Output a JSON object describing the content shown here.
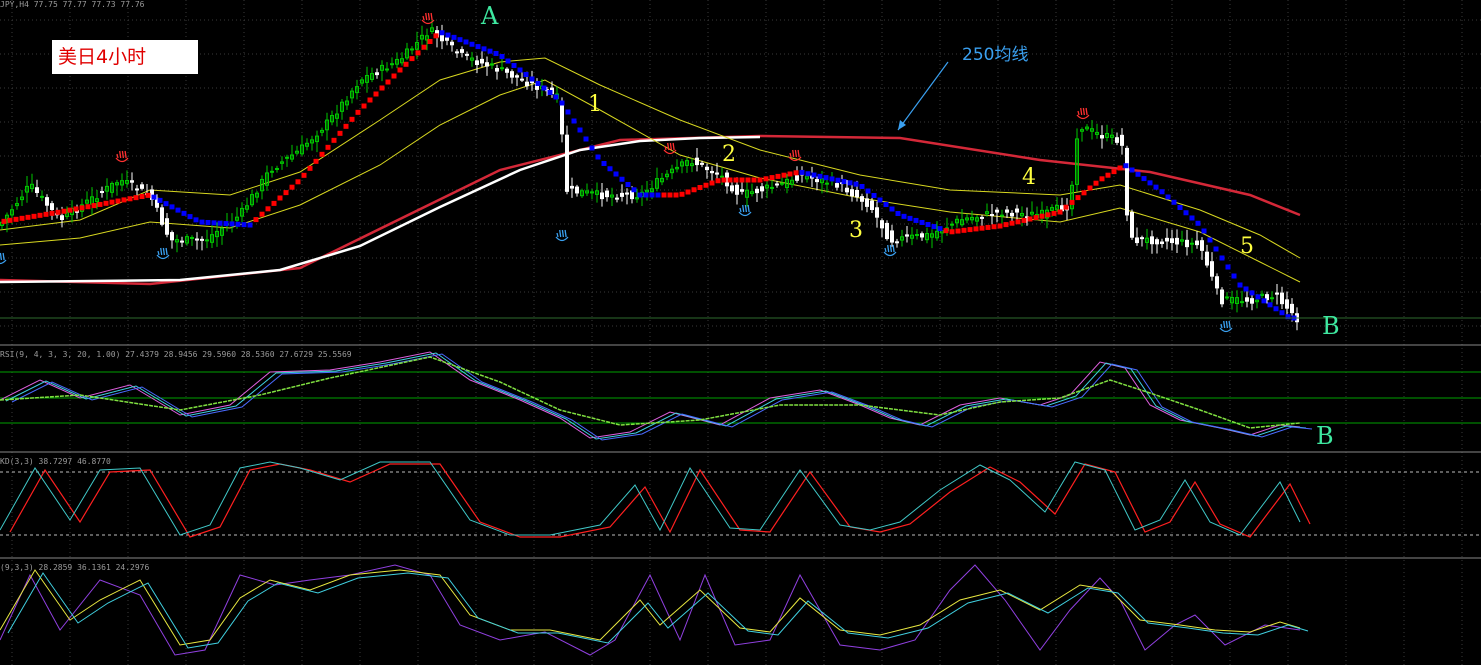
{
  "window": {
    "main_header": "JPY,H4  77.75 77.77 77.73 77.76",
    "rsi_header": "RSI(9, 4, 3, 3, 20, 1.00) 27.4379 28.9456 29.5960 28.5360 27.6729 25.5569",
    "kd_header": "KD(3,3) 38.7297 46.8770",
    "kdj_header": "(9,3,3) 28.2859 36.1361 24.2976"
  },
  "labels": {
    "title": "美日4小时",
    "ma_label": "250均线",
    "peak": "A",
    "bottom": "B",
    "bottom_rsi": "B",
    "wave": [
      "1",
      "2",
      "3",
      "4",
      "5"
    ]
  },
  "colors": {
    "background": "#000000",
    "grid": "#3a3a3a",
    "up_candle": "#00c800",
    "down_candle": "#ffffff",
    "ma250": "#d42838",
    "white_ma": "#ffffff",
    "envelope": "#d8d820",
    "trend_up": "#ff0000",
    "trend_down": "#0000ff",
    "label_green": "#3ee8a0",
    "label_yellow": "#ffff40",
    "label_blue": "#3aa0f0",
    "rsi_magenta": "#e060e0",
    "rsi_cyan": "#40d0e0",
    "rsi_green": "#80e040",
    "kd_red": "#ff2020",
    "kd_cyan": "#40c8c8",
    "kdj_purple": "#9040e0",
    "kdj_yellow": "#e8e840",
    "level_line": "#00a000"
  },
  "chart_data": [
    {
      "type": "candlestick",
      "panel": "price",
      "symbol": "USDJPY",
      "timeframe": "H4",
      "overlays": [
        "MA250",
        "MA (white)",
        "envelope bands",
        "trend dots",
        "fractals"
      ],
      "swing_points": [
        "A",
        "1",
        "2",
        "3",
        "4",
        "5",
        "B"
      ]
    },
    {
      "type": "line",
      "panel": "rsi",
      "series_count": 4
    },
    {
      "type": "line",
      "panel": "kd",
      "series_count": 2
    },
    {
      "type": "line",
      "panel": "kdj",
      "series_count": 3
    }
  ]
}
